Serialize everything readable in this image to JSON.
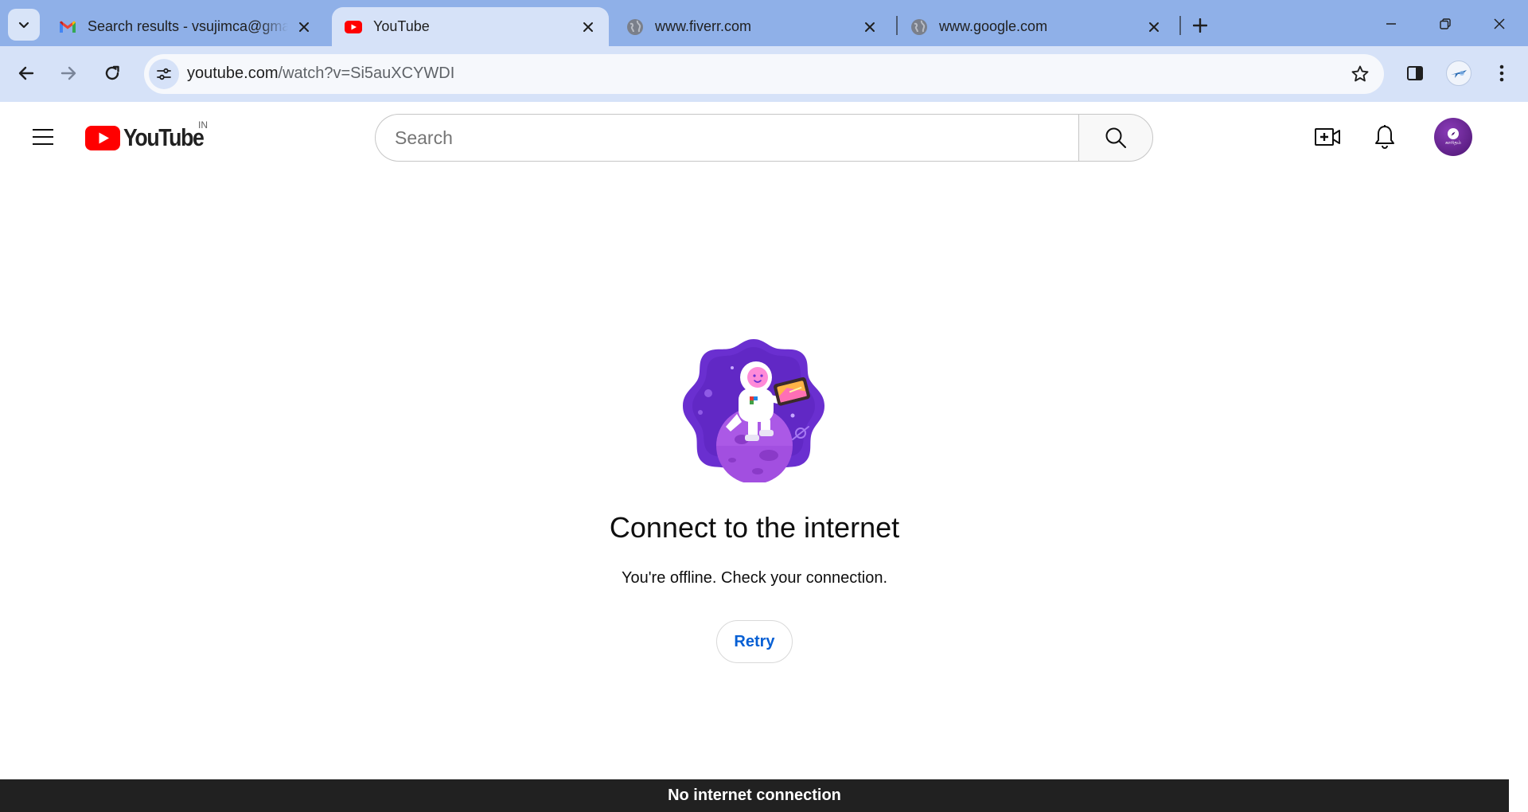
{
  "browser": {
    "tabs": [
      {
        "title": "Search results - vsujimca@gmail.com - Gmail",
        "favicon": "gmail-icon",
        "active": false
      },
      {
        "title": "YouTube",
        "favicon": "youtube-icon",
        "active": true
      },
      {
        "title": "www.fiverr.com",
        "favicon": "globe-icon",
        "active": false
      },
      {
        "title": "www.google.com",
        "favicon": "globe-icon",
        "active": false
      }
    ],
    "url_host": "youtube.com",
    "url_path": "/watch?v=Si5auXCYWDI"
  },
  "youtube": {
    "logo_text": "YouTube",
    "country_code": "IN",
    "search_placeholder": "Search",
    "avatar_text": "காரிதம்"
  },
  "offline": {
    "title": "Connect to the internet",
    "message": "You're offline. Check your connection.",
    "retry_label": "Retry"
  },
  "snackbar": {
    "text": "No internet connection"
  },
  "colors": {
    "tabstrip": "#8fb0e8",
    "toolbar": "#d6e2f8",
    "youtube_red": "#ff0000",
    "link_blue": "#065fd4",
    "illustration_purple": "#6a2fd0"
  }
}
